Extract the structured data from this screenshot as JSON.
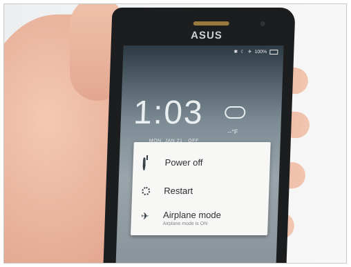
{
  "device": {
    "brand": "ASUS"
  },
  "status_bar": {
    "battery_text": "100%"
  },
  "lockscreen": {
    "time": "1:03",
    "date": "MON, JAN 21 · OFF",
    "temperature": "--°F"
  },
  "power_menu": {
    "items": [
      {
        "label": "Power off",
        "icon": "power-icon"
      },
      {
        "label": "Restart",
        "icon": "restart-icon"
      },
      {
        "label": "Airplane mode",
        "sublabel": "Airplane mode is ON",
        "icon": "airplane-icon"
      }
    ]
  },
  "colors": {
    "accent": "#2a8fd6",
    "menu_bg": "#f7f7f5"
  }
}
